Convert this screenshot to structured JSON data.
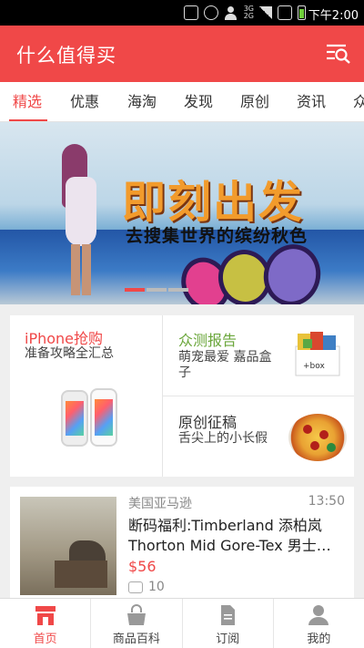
{
  "status_bar": {
    "time": "下午2:00",
    "network_labels": [
      "3G",
      "2G"
    ]
  },
  "app_bar": {
    "title": "什么值得买",
    "action_icon": "search-menu-icon"
  },
  "tabs": [
    {
      "label": "精选",
      "active": true
    },
    {
      "label": "优惠",
      "active": false
    },
    {
      "label": "海淘",
      "active": false
    },
    {
      "label": "发现",
      "active": false
    },
    {
      "label": "原创",
      "active": false
    },
    {
      "label": "资讯",
      "active": false
    },
    {
      "label": "众",
      "active": false
    }
  ],
  "banner": {
    "headline": "即刻出发",
    "subline": "去搜集世界的缤纷秋色",
    "page_count": 3,
    "active_page": 1
  },
  "features": {
    "iphone": {
      "title": "iPhone抢购",
      "subtitle": "准备攻略全汇总"
    },
    "test": {
      "title": "众测报告",
      "subtitle": "萌宠最爱 嘉品盒子",
      "image_label": "+box"
    },
    "original": {
      "title": "原创征稿",
      "subtitle": "舌尖上的小长假"
    }
  },
  "article": {
    "store": "美国亚马逊",
    "time": "13:50",
    "title": "断码福利:Timberland 添柏岚 Thorton Mid Gore-Tex 男士…",
    "price": "$56",
    "comments": "10"
  },
  "bottom_nav": [
    {
      "label": "首页",
      "icon": "home-icon",
      "active": true
    },
    {
      "label": "商品百科",
      "icon": "bag-icon",
      "active": false
    },
    {
      "label": "订阅",
      "icon": "document-icon",
      "active": false
    },
    {
      "label": "我的",
      "icon": "user-icon",
      "active": false
    }
  ],
  "colors": {
    "brand": "#f04848",
    "test_title": "#6aa63a"
  }
}
